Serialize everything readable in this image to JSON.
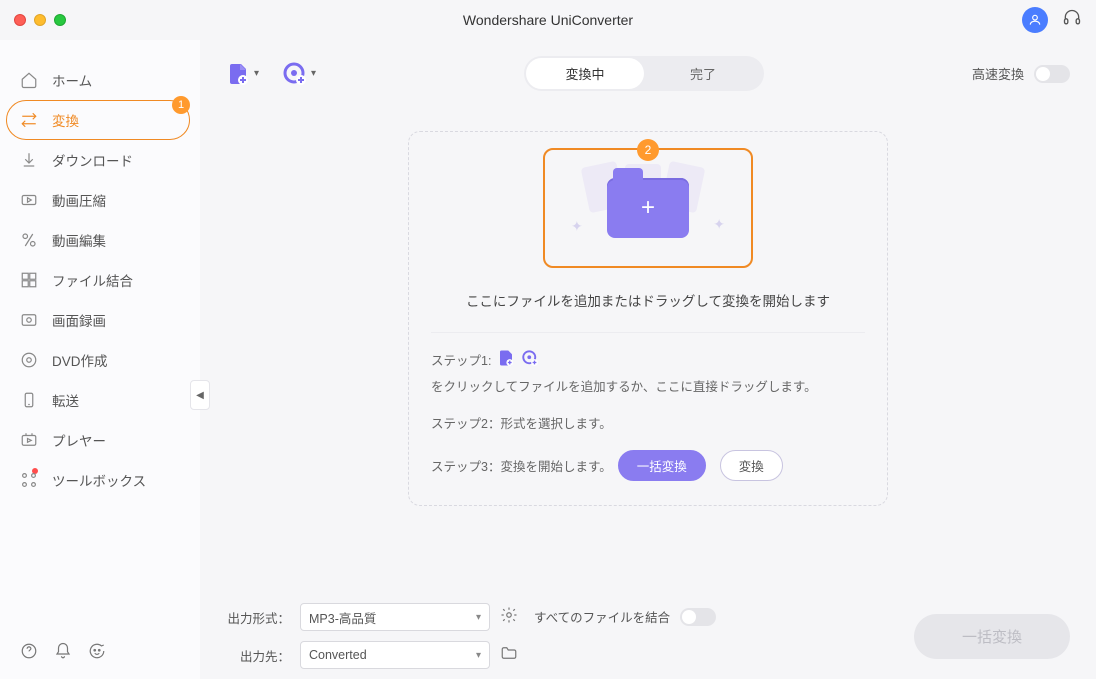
{
  "title": "Wondershare UniConverter",
  "sidebar": {
    "items": [
      {
        "label": "ホーム",
        "icon": "home-icon"
      },
      {
        "label": "変換",
        "icon": "convert-icon",
        "active": true,
        "badge": "1"
      },
      {
        "label": "ダウンロード",
        "icon": "download-icon"
      },
      {
        "label": "動画圧縮",
        "icon": "compress-icon"
      },
      {
        "label": "動画編集",
        "icon": "edit-icon"
      },
      {
        "label": "ファイル結合",
        "icon": "merge-icon"
      },
      {
        "label": "画面録画",
        "icon": "record-icon"
      },
      {
        "label": "DVD作成",
        "icon": "dvd-icon"
      },
      {
        "label": "転送",
        "icon": "transfer-icon"
      },
      {
        "label": "プレヤー",
        "icon": "player-icon"
      },
      {
        "label": "ツールボックス",
        "icon": "toolbox-icon",
        "dot": true
      }
    ]
  },
  "tabs": {
    "converting": "変換中",
    "done": "完了"
  },
  "fast_label": "高速変換",
  "drop": {
    "badge": "2",
    "hint": "ここにファイルを追加またはドラッグして変換を開始します"
  },
  "steps": {
    "s1_pre": "ステップ1:",
    "s1_post": "をクリックしてファイルを追加するか、ここに直接ドラッグします。",
    "s2": "ステップ2：形式を選択します。",
    "s3": "ステップ3：変換を開始します。",
    "btn_batch": "一括変換",
    "btn_single": "変換"
  },
  "bottom": {
    "format_label": "出力形式：",
    "format_value": "MP3-高品質",
    "dest_label": "出力先：",
    "dest_value": "Converted",
    "merge_label": "すべてのファイルを結合",
    "big_button": "一括変換"
  }
}
